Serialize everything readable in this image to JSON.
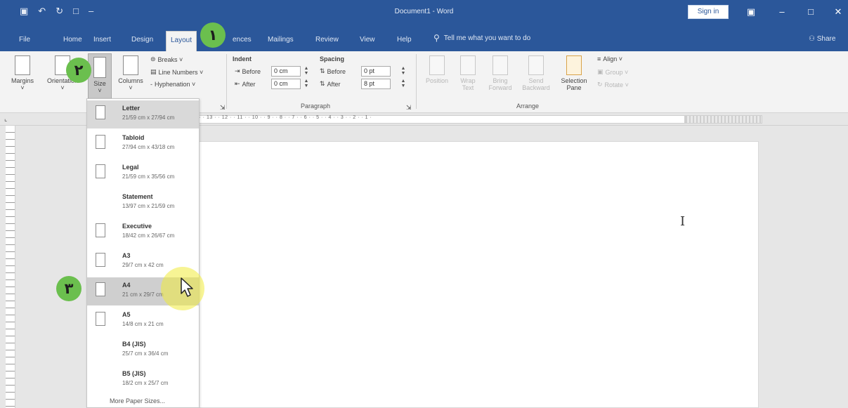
{
  "window": {
    "title": "Document1 - Word",
    "signin_label": "Sign in",
    "colors": {
      "title_bar": "#2b579a",
      "ribbon_bg": "#f3f3f3",
      "badge": "#6bbf4e",
      "highlight": "#f0eb3c"
    }
  },
  "quick_access": {
    "icons": [
      "save-icon",
      "undo-icon",
      "redo-icon",
      "new-document-icon",
      "customize-icon"
    ],
    "glyphs": [
      "▣",
      "↶",
      "↻",
      "□",
      "–"
    ]
  },
  "tabs": [
    "File",
    "Home",
    "Insert",
    "Design",
    "Layout",
    "ences",
    "Mailings",
    "Review",
    "View",
    "Help"
  ],
  "active_tab": "Layout",
  "tell_me": "Tell me what you want to do",
  "share_label": "Share",
  "ribbon": {
    "margins": "Margins",
    "orientation": "Orientation",
    "size": "Size",
    "columns": "Columns",
    "breaks": "Breaks ˅",
    "line_numbers": "Line Numbers ˅",
    "hyphenation": "Hyphenation ˅",
    "indent_label": "Indent",
    "spacing_label": "Spacing",
    "before_label": "Before",
    "after_label": "After",
    "indent_before": "0 cm",
    "indent_after": "0 cm",
    "spacing_before": "0 pt",
    "spacing_after": "8 pt",
    "paragraph_group": "Paragraph",
    "position": "Position",
    "wrap_text": "Wrap Text",
    "bring_forward": "Bring Forward",
    "send_backward": "Send Backward",
    "selection_pane": "Selection Pane",
    "align": "Align ˅",
    "group": "Group ˅",
    "rotate": "Rotate ˅",
    "arrange_group": "Arrange"
  },
  "ruler_numbers": "· 1 · 15 · · 14 · · 13 · · 12 · · 11 · · 10 · · 9 · · 8 · · 7 · · 6 · · 5 · · 4 · · 3 · · 2 · · 1 ·",
  "size_menu": {
    "items": [
      {
        "name": "Letter",
        "dim": "21/59 cm x 27/94 cm"
      },
      {
        "name": "Tabloid",
        "dim": "27/94 cm x 43/18 cm"
      },
      {
        "name": "Legal",
        "dim": "21/59 cm x 35/56 cm"
      },
      {
        "name": "Statement",
        "dim": "13/97 cm x 21/59 cm"
      },
      {
        "name": "Executive",
        "dim": "18/42 cm x 26/67 cm"
      },
      {
        "name": "A3",
        "dim": "29/7 cm x 42 cm"
      },
      {
        "name": "A4",
        "dim": "21 cm x 29/7 cm"
      },
      {
        "name": "A5",
        "dim": "14/8 cm x 21 cm"
      },
      {
        "name": "B4 (JIS)",
        "dim": "25/7 cm x 36/4 cm"
      },
      {
        "name": "B5 (JIS)",
        "dim": "18/2 cm x 25/7 cm"
      }
    ],
    "selected": "A4",
    "more_label": "More Paper Sizes..."
  },
  "badges": [
    "١",
    "٢",
    "٣"
  ]
}
